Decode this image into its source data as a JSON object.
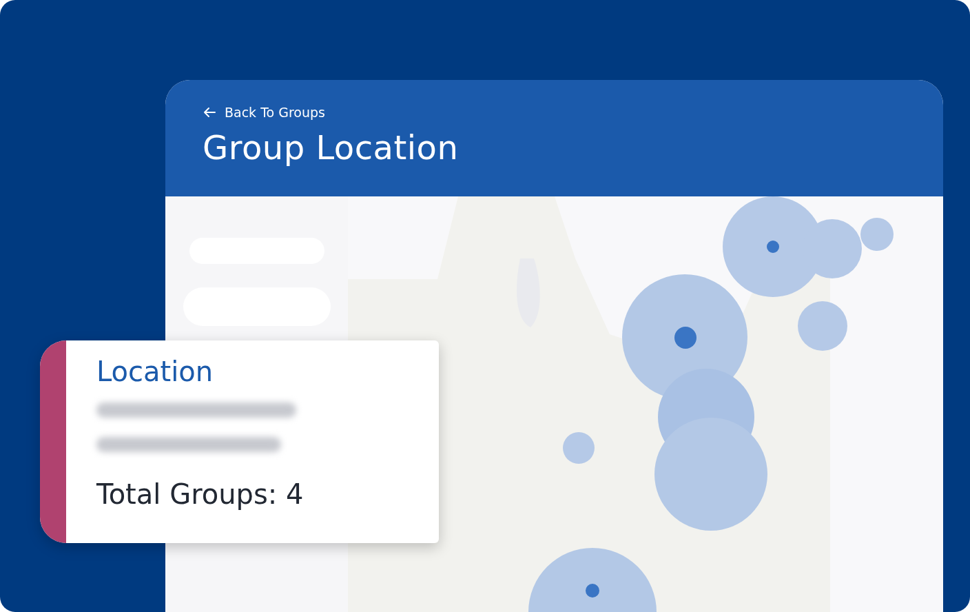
{
  "header": {
    "back_link": "Back To Groups",
    "title": "Group Location"
  },
  "location_card": {
    "heading": "Location",
    "total": "Total Groups: 4"
  }
}
